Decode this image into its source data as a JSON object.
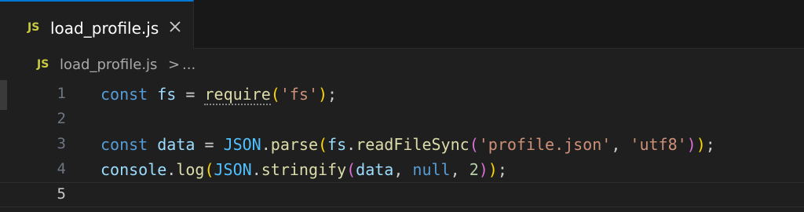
{
  "tab": {
    "icon": "JS",
    "label": "load_profile.js",
    "close": "close-icon"
  },
  "breadcrumb": {
    "icon": "JS",
    "file": "load_profile.js",
    "separator": ">",
    "more": "..."
  },
  "editor": {
    "lines": [
      {
        "number": "1"
      },
      {
        "number": "2"
      },
      {
        "number": "3"
      },
      {
        "number": "4"
      },
      {
        "number": "5"
      }
    ],
    "tokens": {
      "l1": [
        "const",
        " ",
        "fs",
        " = ",
        "require",
        "(",
        "'fs'",
        ")",
        ";"
      ],
      "l3": [
        "const",
        " ",
        "data",
        " = ",
        "JSON",
        ".",
        "parse",
        "(",
        "fs",
        ".",
        "readFileSync",
        "(",
        "'profile.json'",
        ", ",
        "'utf8'",
        ")",
        ")",
        ";"
      ],
      "l4": [
        "console",
        ".",
        "log",
        "(",
        "JSON",
        ".",
        "stringify",
        "(",
        "data",
        ", ",
        "null",
        ", ",
        "2",
        ")",
        ")",
        ";"
      ]
    }
  },
  "colors": {
    "accent": "#0078d4",
    "keyword": "#569cd6",
    "string": "#ce9178",
    "function": "#dcdcaa",
    "js_icon": "#cbcb41"
  }
}
